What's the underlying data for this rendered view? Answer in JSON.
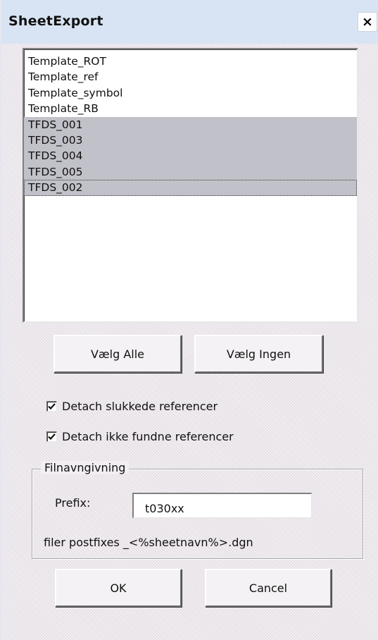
{
  "window": {
    "title": "SheetExport",
    "close_label": "×"
  },
  "sheet_list": {
    "items": [
      {
        "label": "Template_ROT",
        "selected": false
      },
      {
        "label": "Template_ref",
        "selected": false
      },
      {
        "label": "Template_symbol",
        "selected": false
      },
      {
        "label": "Template_RB",
        "selected": false
      },
      {
        "label": "TFDS_001",
        "selected": true
      },
      {
        "label": "TFDS_003",
        "selected": true
      },
      {
        "label": "TFDS_004",
        "selected": true
      },
      {
        "label": "TFDS_005",
        "selected": true
      },
      {
        "label": "TFDS_002",
        "selected": true,
        "focused": true
      }
    ]
  },
  "buttons": {
    "select_all": "Vælg Alle",
    "select_none": "Vælg Ingen",
    "ok": "OK",
    "cancel": "Cancel"
  },
  "options": {
    "detach_off": {
      "label": "Detach slukkede referencer",
      "checked": true
    },
    "detach_missing": {
      "label": "Detach ikke fundne referencer",
      "checked": true
    }
  },
  "naming": {
    "group_label": "Filnavngivning",
    "prefix_label": "Prefix:",
    "prefix_value": "t030xx",
    "postfix_note": "filer postfixes _<%sheetnavn%>.dgn"
  }
}
